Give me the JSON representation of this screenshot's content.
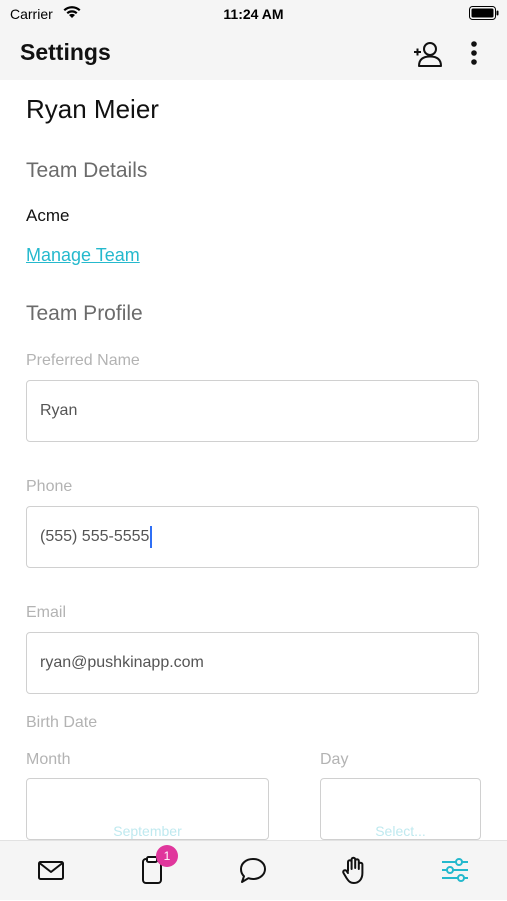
{
  "status_bar": {
    "carrier": "Carrier",
    "time": "11:24 AM"
  },
  "header": {
    "title": "Settings",
    "actions": [
      "add-user-icon",
      "more-vertical-icon"
    ]
  },
  "profile": {
    "name": "Ryan Meier"
  },
  "team_details": {
    "title": "Team Details",
    "team_name": "Acme",
    "manage_link": "Manage Team"
  },
  "team_profile": {
    "title": "Team Profile",
    "preferred_name": {
      "label": "Preferred Name",
      "value": "Ryan"
    },
    "phone": {
      "label": "Phone",
      "value": "(555) 555-5555"
    },
    "email": {
      "label": "Email",
      "value": "ryan@pushkinapp.com"
    },
    "birth_date": {
      "label": "Birth Date",
      "month_label": "Month",
      "month_value": "September",
      "day_label": "Day",
      "day_value": "Select..."
    }
  },
  "tab_bar": {
    "tabs": [
      "mail-icon",
      "clipboard-icon",
      "chat-icon",
      "hand-icon",
      "settings-sliders-icon"
    ],
    "active_tab": "settings-sliders-icon",
    "clipboard_badge": "1"
  },
  "colors": {
    "accent": "#25b9cd",
    "badge": "#e0369c",
    "caret": "#2f6ff5"
  }
}
